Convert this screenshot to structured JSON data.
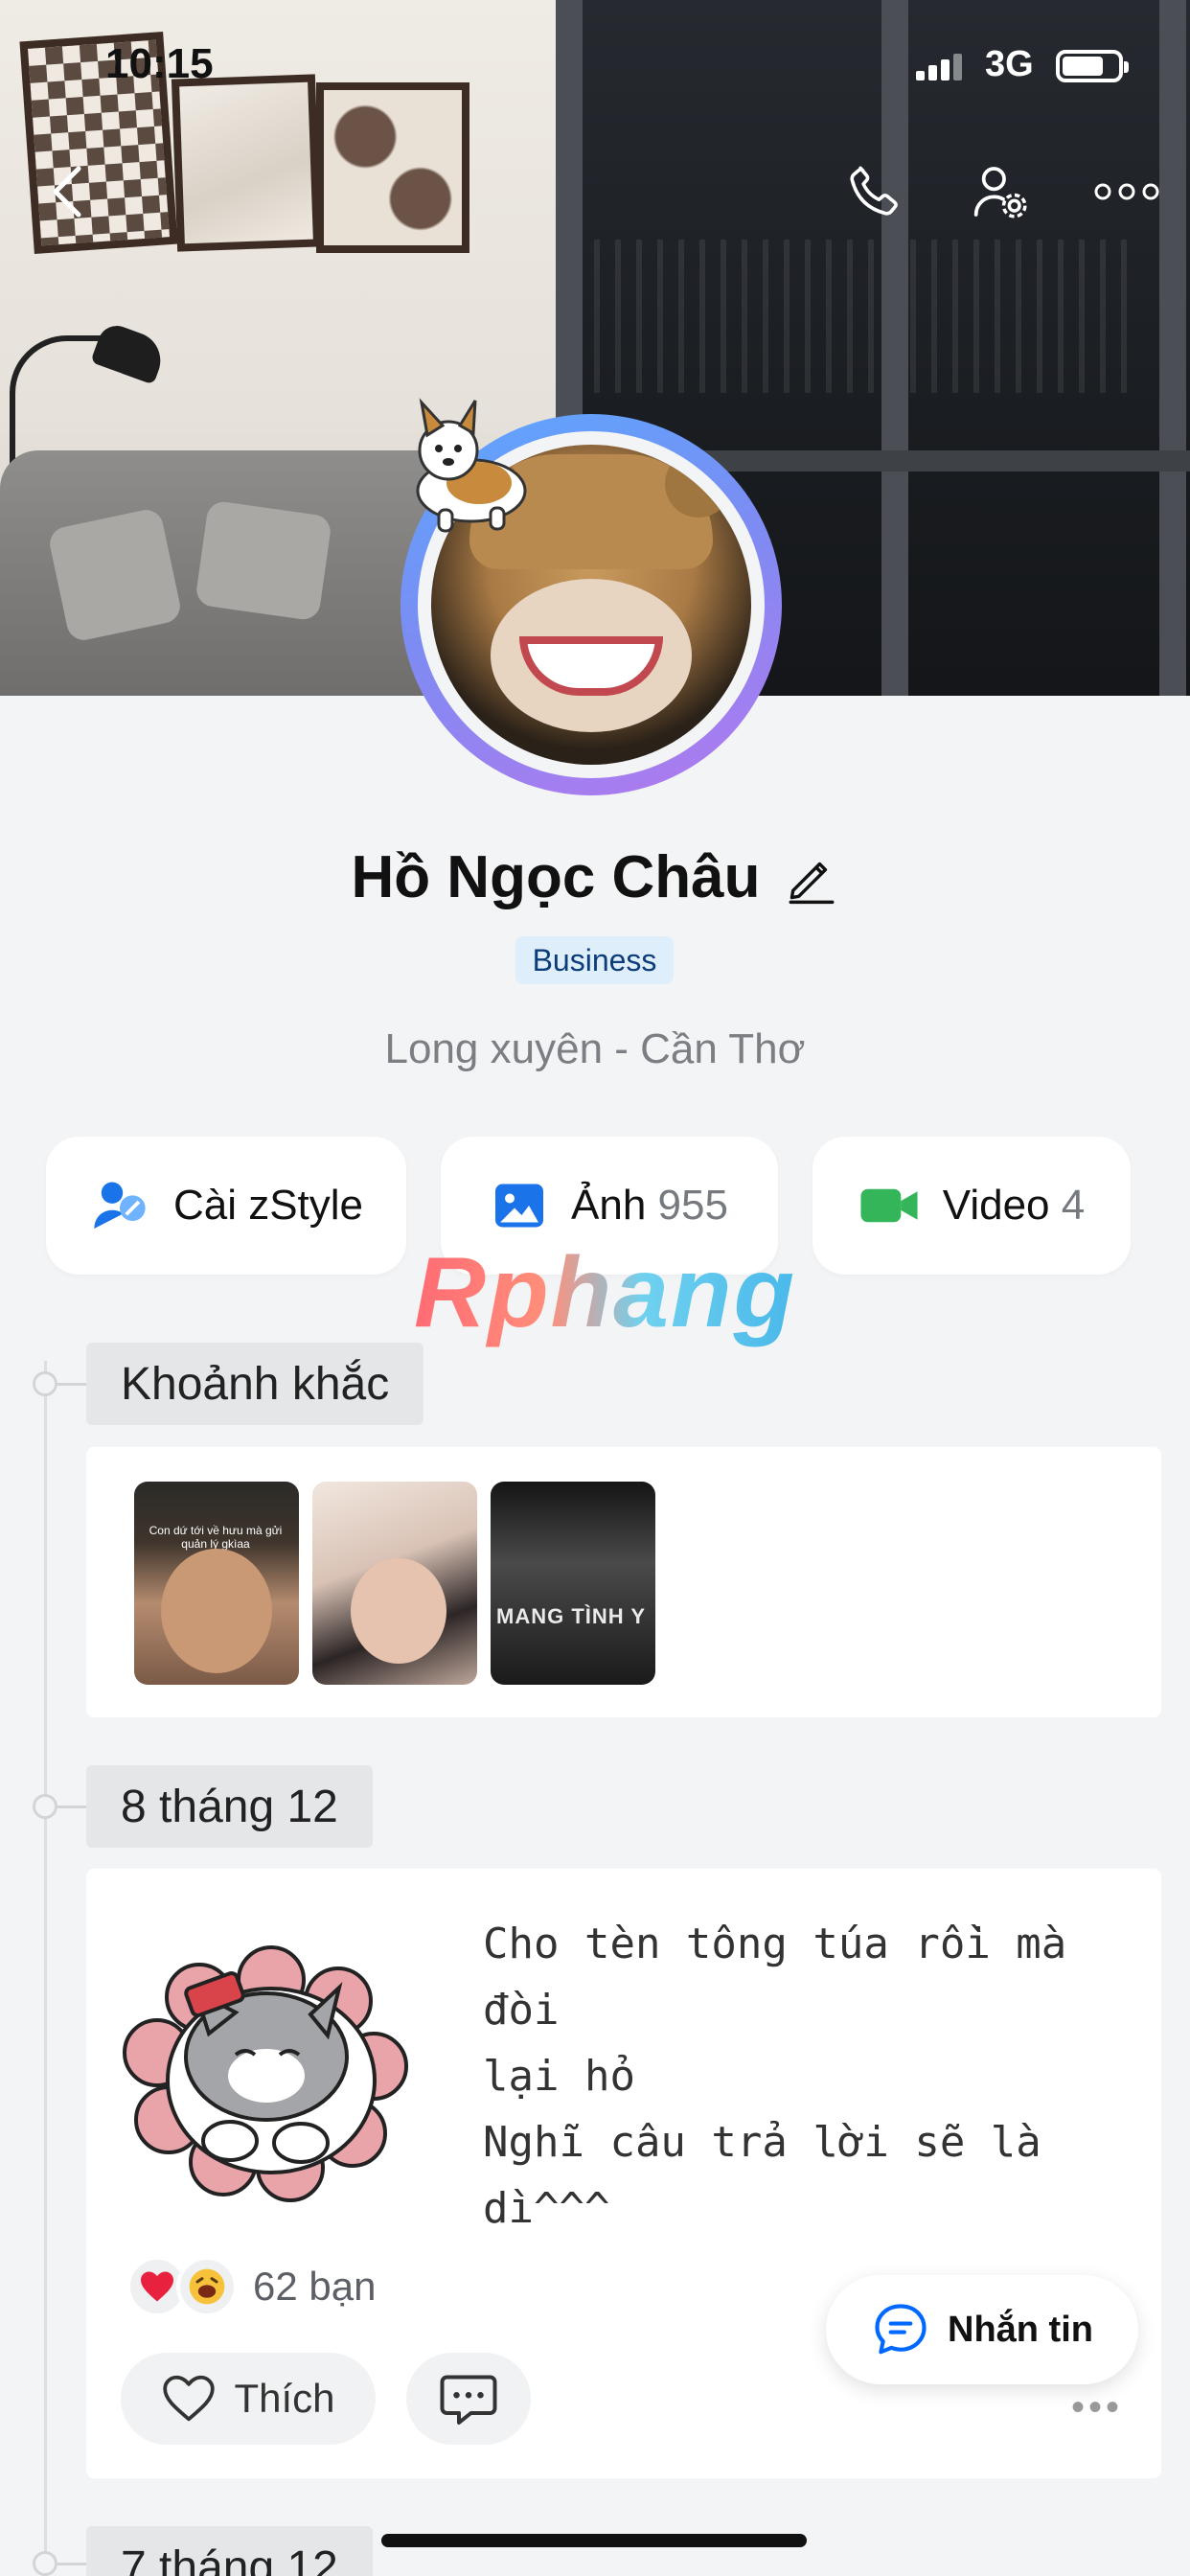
{
  "status_bar": {
    "time": "10:15",
    "network": "3G",
    "battery_level": 0.75
  },
  "profile": {
    "name": "Hồ Ngọc Châu",
    "badge": "Business",
    "location": "Long xuyên - Cần Thơ"
  },
  "quick_actions": {
    "zstyle": {
      "label": "Cài zStyle"
    },
    "photos": {
      "label": "Ảnh",
      "count": "955"
    },
    "videos": {
      "label": "Video",
      "count": "4"
    }
  },
  "watermark": "Rphang",
  "timeline": {
    "moments": {
      "label": "Khoảnh khắc",
      "thumbs": [
        {
          "caption": "Con dứ tới về hưu mà gửi quản lý gkìaa"
        },
        {
          "caption": ""
        },
        {
          "caption": "MANG TÌNH Y"
        }
      ]
    },
    "post": {
      "date_label": "8 tháng 12",
      "text": "Cho tèn tông túa rồi mà đòi\nlại hỏ\nNghĩ câu trả lời sẽ là\ndì^^^",
      "reaction_count": "62 bạn",
      "like_label": "Thích",
      "more_label": "•••"
    },
    "next_date_label": "7 tháng 12"
  },
  "fab": {
    "label": "Nhắn tin"
  },
  "colors": {
    "accent_blue": "#0068ff",
    "video_green": "#34b55a",
    "badge_bg": "#dfeefb",
    "ring_start": "#5aa8ff",
    "ring_end": "#b478ee"
  },
  "icons": {
    "back": "chevron-left-icon",
    "phone": "phone-icon",
    "user_settings": "user-gear-icon",
    "more": "more-dots-icon",
    "edit": "pencil-icon",
    "zstyle": "zstyle-icon",
    "photo": "photo-icon",
    "video": "video-icon",
    "heart": "heart-icon",
    "comment": "comment-icon",
    "chat": "chat-icon"
  }
}
